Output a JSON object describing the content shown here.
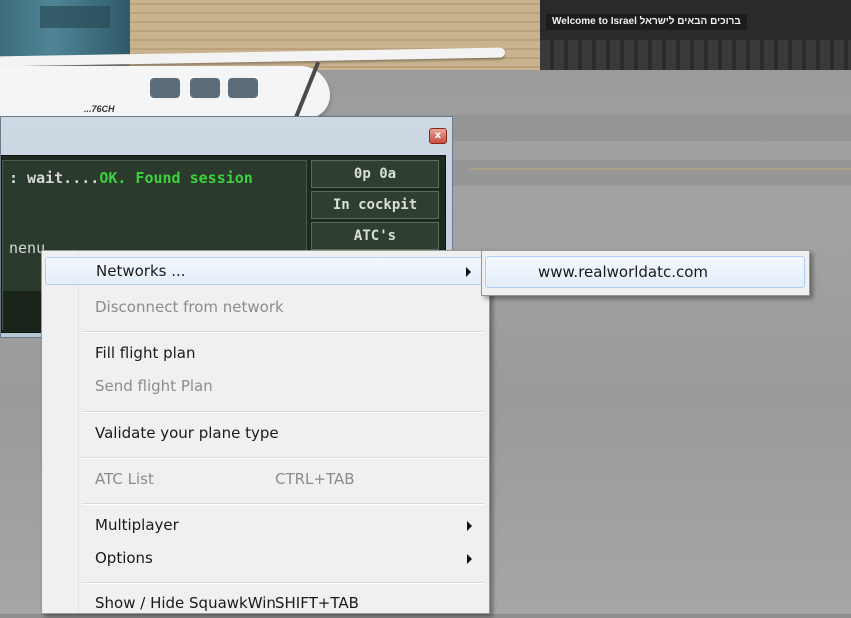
{
  "scene": {
    "sign_text": "Welcome to Israel ברוכים הבאים לישראל",
    "plane_registration": "...76CH"
  },
  "dialog": {
    "close_glyph": "x",
    "console_line1_prefix": ": wait....",
    "console_line1_ok": "OK. Found session",
    "console_line2": "nenu",
    "status_cells": [
      "0p 0a",
      "In cockpit",
      "ATC's"
    ]
  },
  "menu": {
    "items": [
      {
        "label": "Networks ...",
        "shortcut": "",
        "submenu": true,
        "disabled": false,
        "hover": true
      },
      {
        "label": "Disconnect from network",
        "shortcut": "",
        "submenu": false,
        "disabled": true
      },
      {
        "label": "Fill flight plan",
        "shortcut": "",
        "submenu": false,
        "disabled": false
      },
      {
        "label": "Send flight Plan",
        "shortcut": "",
        "submenu": false,
        "disabled": true
      },
      {
        "label": "Validate your plane type",
        "shortcut": "",
        "submenu": false,
        "disabled": false
      },
      {
        "label": "ATC List",
        "shortcut": "CTRL+TAB",
        "submenu": false,
        "disabled": true
      },
      {
        "label": "Multiplayer",
        "shortcut": "",
        "submenu": true,
        "disabled": false
      },
      {
        "label": "Options",
        "shortcut": "",
        "submenu": true,
        "disabled": false
      },
      {
        "label": "Show / Hide SquawkWin",
        "shortcut": "SHIFT+TAB",
        "submenu": false,
        "disabled": false
      }
    ]
  },
  "submenu": {
    "items": [
      {
        "label": "www.realworldatc.com"
      }
    ]
  },
  "colors": {
    "ok_text": "#3bd33b",
    "menu_highlight": "#aecff7",
    "disabled_text": "#8c8c8c"
  }
}
